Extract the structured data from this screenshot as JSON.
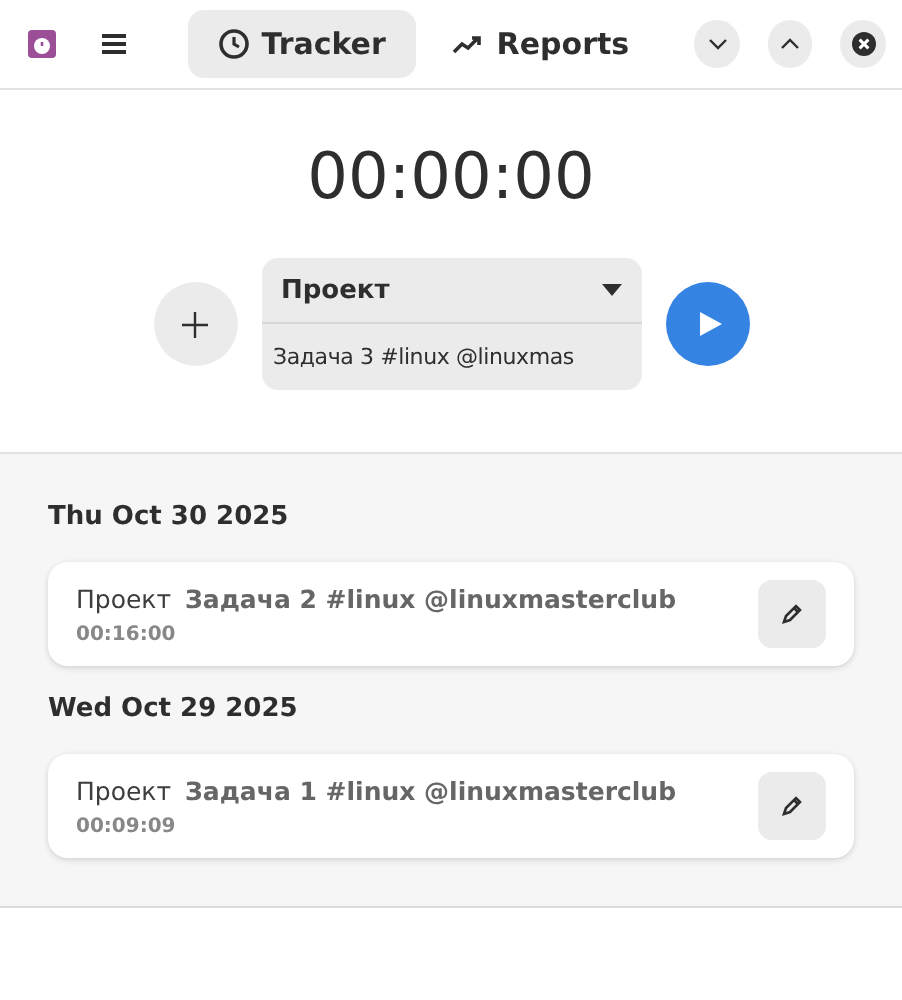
{
  "header": {
    "tabs": [
      {
        "label": "Tracker",
        "kind": "clock",
        "selected": true
      },
      {
        "label": "Reports",
        "kind": "trend",
        "selected": false
      }
    ]
  },
  "timer": {
    "display": "00:00:00",
    "project": "Проект",
    "task": "Задача 3 #linux @linuxmas"
  },
  "days": [
    {
      "date": "Thu Oct 30 2025",
      "entries": [
        {
          "project": "Проект",
          "task": "Задача 2 #linux @linuxmasterclub",
          "duration": "00:16:00"
        }
      ]
    },
    {
      "date": "Wed Oct 29 2025",
      "entries": [
        {
          "project": "Проект",
          "task": "Задача 1 #linux @linuxmasterclub",
          "duration": "00:09:09"
        }
      ]
    }
  ]
}
